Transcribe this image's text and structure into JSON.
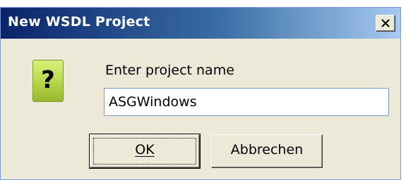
{
  "dialog": {
    "title": "New WSDL Project",
    "close_symbol": "×",
    "icon": "question-icon",
    "icon_glyph": "?",
    "prompt": "Enter project name",
    "input_value": "ASGWindows",
    "buttons": {
      "ok_label": "OK",
      "cancel_label": "Abbrechen"
    }
  },
  "colors": {
    "titlebar_start": "#0a246a",
    "titlebar_end": "#a6caf0",
    "dialog_bg": "#ece9d8",
    "icon_green": "#b6d64a"
  }
}
